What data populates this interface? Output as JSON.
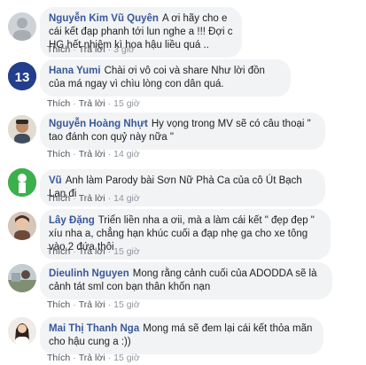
{
  "actions": {
    "like": "Thích",
    "reply": "Trả lời"
  },
  "comments": [
    {
      "author": "Nguyễn Kim Vũ Quyên",
      "text": "A ơi hãy cho e cái kết đạp phanh tới lun nghe a !!! Đợi c HG hết nhiệm kì hoa hậu liều quá ..",
      "time": "3 giờ"
    },
    {
      "author": "Hana Yumi",
      "text": "Chài ơi vô coi và share Như lời đồn của má ngay vì chìu lòng con dân quá.",
      "time": "15 giờ"
    },
    {
      "author": "Nguyễn Hoàng Nhựt",
      "text": "Hy vọng trong MV sẽ có câu thoại \" tao đánh con quỷ này nữa \"",
      "time": "14 giờ"
    },
    {
      "author": "Vũ",
      "text": "Anh làm Parody bài Sơn Nữ Phà Ca của cô Út Bạch Lan đi",
      "time": "14 giờ"
    },
    {
      "author": "Lây Đặng",
      "text": "Triển liền nha a ơii, mà a làm cái kết \" đẹp đẹp \" xíu nha a, chẳng hạn khúc cuối a đạp nhẹ ga cho xe tông vào 2 đứa thôi",
      "time": "15 giờ"
    },
    {
      "author": "Dieulinh Nguyen",
      "text": "Mong rằng cảnh cuối của ADODDA sẽ là cảnh tát sml con bạn thân khốn nạn",
      "time": "15 giờ"
    },
    {
      "author": "Mai Thị Thanh Nga",
      "text": "Mong má sẽ đem lại cái kết thỏa mãn cho hậu cung a :))",
      "time": "15 giờ"
    }
  ]
}
